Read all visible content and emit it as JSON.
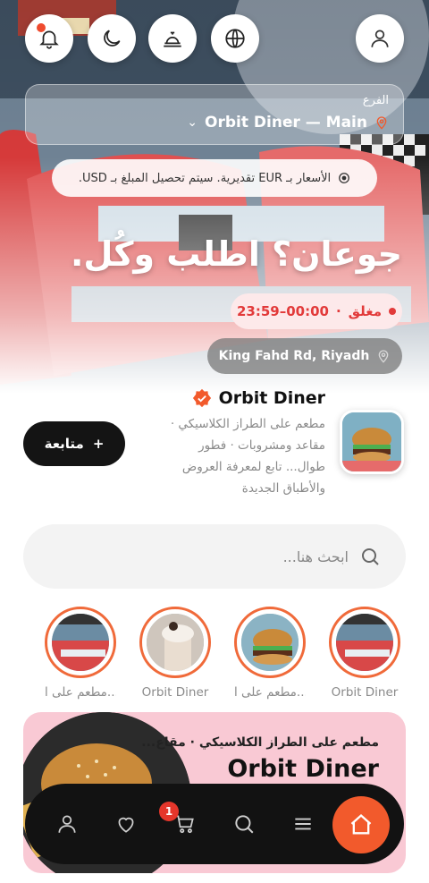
{
  "colors": {
    "accent": "#f25a2c",
    "status_closed": "#e23a3a",
    "promo_bg": "#f9c9d4",
    "nav_bg": "#121212"
  },
  "header": {
    "buttons": [
      {
        "icon": "user-icon"
      },
      {
        "icon": "globe-icon"
      },
      {
        "icon": "service-bell-icon"
      },
      {
        "icon": "moon-icon"
      },
      {
        "icon": "bell-icon",
        "has_notification": true
      }
    ]
  },
  "branch": {
    "label": "الفرع",
    "name": "Orbit Diner — Main",
    "icon": "location-pin-icon"
  },
  "currency_notice": {
    "text": "الأسعار بـ EUR تقديرية. سيتم تحصيل المبلغ بـ USD.",
    "icon": "info-icon"
  },
  "hero": {
    "title": "جوعان؟ اطلب وكُل."
  },
  "status": {
    "state": "مغلق",
    "hours": "00:00–23:59"
  },
  "address": {
    "text": "King Fahd Rd, Riyadh",
    "icon": "location-pin-icon"
  },
  "profile": {
    "name": "Orbit Diner",
    "verified": true,
    "description": "مطعم على الطراز الكلاسيكي · مقاعد ومشروبات · فطور طوال... تابع لمعرفة العروض والأطباق الجديدة",
    "follow_label": "متابعة"
  },
  "search": {
    "placeholder": "ابحث هنا..."
  },
  "stories": [
    {
      "label": "Orbit Diner",
      "image": "diner-booth"
    },
    {
      "label": "مطعم على ا...",
      "image": "burger"
    },
    {
      "label": "Orbit Diner",
      "image": "milkshake"
    },
    {
      "label": "مطعم على ا...",
      "image": "diner-booth"
    }
  ],
  "promo": {
    "subtitle": "مطعم على الطراز الكلاسيكي · مقاع...",
    "title": "Orbit Diner"
  },
  "bottom_nav": {
    "items": [
      "home-icon",
      "menu-icon",
      "search-icon",
      "cart-icon",
      "heart-icon",
      "user-icon"
    ],
    "cart_count": "1",
    "active": "home"
  }
}
